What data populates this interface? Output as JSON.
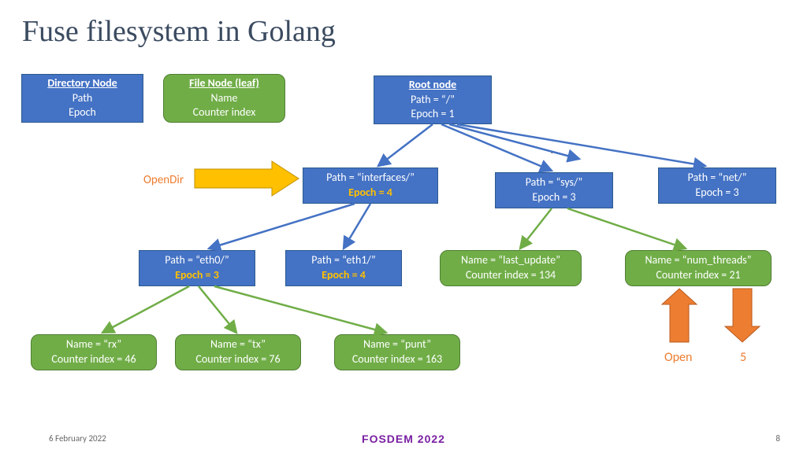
{
  "title": "Fuse filesystem in Golang",
  "legend": {
    "dir": {
      "header": "Directory Node",
      "l1": "Path",
      "l2": "Epoch"
    },
    "file": {
      "header": "File Node (leaf)",
      "l1": "Name",
      "l2": "Counter index"
    }
  },
  "root": {
    "header": "Root node",
    "l1": "Path = “/”",
    "l2": "Epoch = 1"
  },
  "ellipsis": "…",
  "level1": {
    "interfaces": {
      "l1": "Path = “interfaces/”",
      "l2": "Epoch = 4"
    },
    "sys": {
      "l1": "Path = “sys/”",
      "l2": "Epoch = 3"
    },
    "net": {
      "l1": "Path = “net/”",
      "l2": "Epoch = 3"
    }
  },
  "level2": {
    "eth0": {
      "l1": "Path = “eth0/”",
      "l2": "Epoch = 3"
    },
    "eth1": {
      "l1": "Path = “eth1/”",
      "l2": "Epoch = 4"
    },
    "last_update": {
      "l1": "Name = “last_update”",
      "l2": "Counter index = 134"
    },
    "num_threads": {
      "l1": "Name = “num_threads”",
      "l2": "Counter index = 21"
    }
  },
  "level3": {
    "rx": {
      "l1": "Name = “rx”",
      "l2": "Counter index = 46"
    },
    "tx": {
      "l1": "Name = “tx”",
      "l2": "Counter index = 76"
    },
    "punt": {
      "l1": "Name = “punt”",
      "l2": "Counter index = 163"
    }
  },
  "labels": {
    "opendir": "OpenDir",
    "open": "Open",
    "five": "5"
  },
  "footer": {
    "date": "6 February 2022",
    "conf": "FOSDEM 2022",
    "page": "8"
  }
}
